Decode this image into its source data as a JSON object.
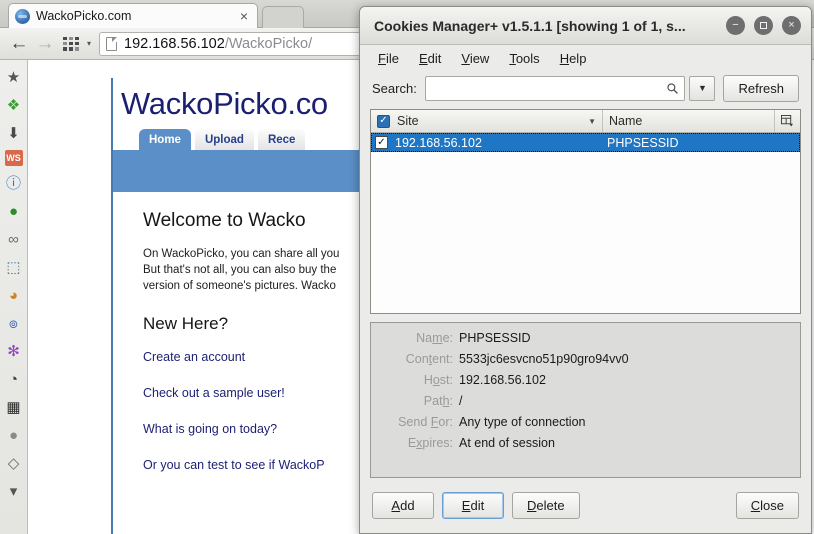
{
  "browser": {
    "tab": {
      "title": "WackoPicko.com",
      "favicon": "globe-icon",
      "close": "×"
    },
    "nav": {
      "back": "←",
      "forward": "→",
      "apps_caret": "▾"
    },
    "url": {
      "host": "192.168.56.102",
      "path": "/WackoPicko/"
    },
    "sidebar_icons": [
      {
        "name": "bookmark-star-icon",
        "glyph": "★",
        "color": "#555555"
      },
      {
        "name": "puzzle-addon-icon",
        "glyph": "❖",
        "color": "#3f9c35"
      },
      {
        "name": "download-arrow-icon",
        "glyph": "⬇",
        "color": "#4a4a4a"
      },
      {
        "name": "websecurify-icon",
        "glyph": "WS",
        "color": "#d9694a"
      },
      {
        "name": "info-bubble-icon",
        "glyph": "ⓘ",
        "color": "#3a73b8"
      },
      {
        "name": "green-globe-icon",
        "glyph": "●",
        "color": "#2e8b2e"
      },
      {
        "name": "chain-link-icon",
        "glyph": "∞",
        "color": "#7a6a58"
      },
      {
        "name": "cursor-box-icon",
        "glyph": "⬚",
        "color": "#4a6fa5"
      },
      {
        "name": "user-avatar-icon",
        "glyph": "◕",
        "color": "#c8862a"
      },
      {
        "name": "blue-swirl-icon",
        "glyph": "๏",
        "color": "#3a5fbf"
      },
      {
        "name": "purple-bug-icon",
        "glyph": "✻",
        "color": "#8e44c0"
      },
      {
        "name": "cookie-icon",
        "glyph": "◔",
        "color": "#3a3a3a"
      },
      {
        "name": "grid-box-icon",
        "glyph": "▦",
        "color": "#2a2a2a"
      },
      {
        "name": "sphere-menu-icon",
        "glyph": "●",
        "color": "#8a8a8a"
      },
      {
        "name": "paint-bucket-icon",
        "glyph": "◇",
        "color": "#6a6a6a"
      },
      {
        "name": "overflow-chevron-icon",
        "glyph": "▾",
        "color": "#555555"
      }
    ]
  },
  "page": {
    "logo": "WackoPicko.co",
    "tabs": [
      {
        "label": "Home",
        "active": true
      },
      {
        "label": "Upload",
        "active": false
      },
      {
        "label": "Rece",
        "active": false
      }
    ],
    "heading": "Welcome to Wacko",
    "paragraph_lines": [
      "On WackoPicko, you can share all you",
      "But that's not all, you can also buy the",
      "version of someone's pictures. Wacko"
    ],
    "subheading": "New Here?",
    "links": [
      "Create an account",
      "Check out a sample user!",
      "What is going on today?",
      "Or you can test to see if WackoP"
    ],
    "banner_color": "#5b8fc7",
    "link_color": "#1b1f72"
  },
  "dialog": {
    "title": "Cookies Manager+ v1.5.1.1 [showing 1 of 1, s...",
    "window_buttons": {
      "minimize": "−",
      "maximize": "square-icon",
      "close": "×"
    },
    "menu": [
      {
        "key": "F",
        "rest": "ile"
      },
      {
        "key": "E",
        "rest": "dit"
      },
      {
        "key": "V",
        "rest": "iew"
      },
      {
        "key": "T",
        "rest": "ools"
      },
      {
        "key": "H",
        "rest": "elp"
      }
    ],
    "search": {
      "label": "Search:",
      "value": "",
      "placeholder": ""
    },
    "refresh_label": "Refresh",
    "table": {
      "columns": [
        {
          "label": "Site",
          "sort": "▼",
          "checked": true
        },
        {
          "label": "Name"
        }
      ],
      "rows": [
        {
          "checked": true,
          "site": "192.168.56.102",
          "name": "PHPSESSID",
          "selected": true
        }
      ]
    },
    "details": [
      {
        "label_pre": "Na",
        "label_key": "m",
        "label_post": "e:",
        "value": "PHPSESSID"
      },
      {
        "label_pre": "Con",
        "label_key": "t",
        "label_post": "ent:",
        "value": "5533jc6esvcno51p90gro94vv0"
      },
      {
        "label_pre": "H",
        "label_key": "o",
        "label_post": "st:",
        "value": "192.168.56.102"
      },
      {
        "label_pre": "Pat",
        "label_key": "h",
        "label_post": ":",
        "value": "/"
      },
      {
        "label_pre": "Send ",
        "label_key": "F",
        "label_post": "or:",
        "value": "Any type of connection"
      },
      {
        "label_pre": "E",
        "label_key": "x",
        "label_post": "pires:",
        "value": "At end of session"
      }
    ],
    "buttons": [
      {
        "key": "A",
        "rest": "dd",
        "focused": false
      },
      {
        "key": "E",
        "rest": "dit",
        "focused": true
      },
      {
        "key": "D",
        "rest": "elete",
        "focused": false
      }
    ],
    "close_button": {
      "key": "C",
      "rest": "lose"
    },
    "selection_color": "#1f76c4"
  }
}
